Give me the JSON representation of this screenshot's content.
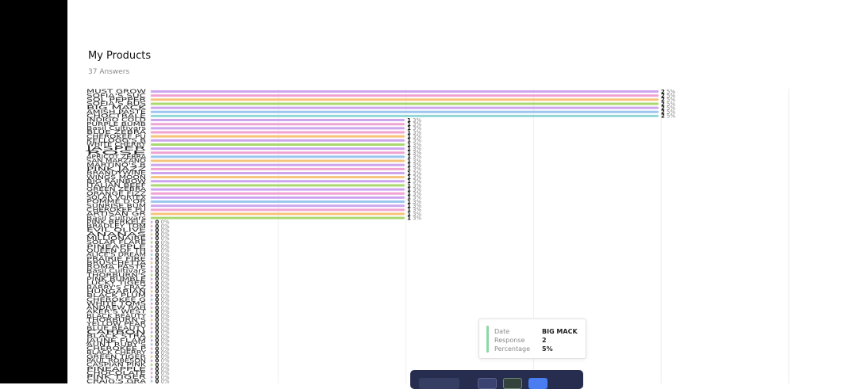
{
  "header": {
    "title": "My Products",
    "subtitle": "37 Answers"
  },
  "tooltip": {
    "date_label": "Date",
    "date_value": "BIG MACK",
    "response_label": "Response",
    "response_value": "2",
    "percentage_label": "Percentage",
    "percentage_value": "5%"
  },
  "colors": {
    "purple": "#cda5ee",
    "pink": "#f0a3d2",
    "orange": "#f7c37a",
    "green": "#a9d86e",
    "blue": "#9cc5ef",
    "teal": "#93d6d6",
    "toolbar": "#262d4f"
  },
  "chart_data": {
    "type": "bar",
    "orientation": "horizontal",
    "xlim": [
      0,
      2
    ],
    "grid": true,
    "items": [
      {
        "label": "MUST GROW",
        "value": 2,
        "pct": "5%",
        "color": "purple"
      },
      {
        "label": "SOFIA'S SUC",
        "value": 2,
        "pct": "5%",
        "color": "pink"
      },
      {
        "label": "SOL PEPPER",
        "value": 2,
        "pct": "5%",
        "color": "orange"
      },
      {
        "label": "SOFIA'S BUS",
        "value": 2,
        "pct": "5%",
        "color": "green"
      },
      {
        "label": "BIG MACK",
        "value": 2,
        "pct": "5%",
        "color": "purple"
      },
      {
        "label": "AMISH PASTE",
        "value": 2,
        "pct": "5%",
        "color": "blue"
      },
      {
        "label": "CHOCTRALE",
        "value": 2,
        "pct": "5%",
        "color": "teal"
      },
      {
        "label": "INDIGO COLD",
        "value": 1,
        "pct": "3%",
        "color": "purple"
      },
      {
        "label": "PURPLE BUMB",
        "value": 1,
        "pct": "3%",
        "color": "pink"
      },
      {
        "label": "Basil Cultivars",
        "value": 1,
        "pct": "3%",
        "color": "purple"
      },
      {
        "label": "BLUE ZEBRA",
        "value": 1,
        "pct": "3%",
        "color": "pink"
      },
      {
        "label": "CHEROKEE PU",
        "value": 1,
        "pct": "3%",
        "color": "orange"
      },
      {
        "label": "KELLOGG'S B",
        "value": 1,
        "pct": "3%",
        "color": "purple"
      },
      {
        "label": "WHITE CHERRY",
        "value": 1,
        "pct": "3%",
        "color": "green"
      },
      {
        "label": "JASPER",
        "value": 1,
        "pct": "3%",
        "color": "purple"
      },
      {
        "label": "ROSE",
        "value": 1,
        "pct": "3%",
        "color": "pink"
      },
      {
        "label": "APRICOT ZEBRA",
        "value": 1,
        "pct": "3%",
        "color": "blue"
      },
      {
        "label": "SAN MARZANO",
        "value": 1,
        "pct": "3%",
        "color": "orange"
      },
      {
        "label": "MARTINO'S R",
        "value": 1,
        "pct": "3%",
        "color": "purple"
      },
      {
        "label": "PINK JAZZ",
        "value": 1,
        "pct": "3%",
        "color": "pink"
      },
      {
        "label": "BRANDYWINE",
        "value": 1,
        "pct": "3%",
        "color": "purple"
      },
      {
        "label": "WINGS MOON",
        "value": 1,
        "pct": "3%",
        "color": "orange"
      },
      {
        "label": "BIG RAINBOW",
        "value": 1,
        "pct": "3%",
        "color": "purple"
      },
      {
        "label": "ITALIAN BEEF",
        "value": 1,
        "pct": "3%",
        "color": "green"
      },
      {
        "label": "GREEN ZEBRA",
        "value": 1,
        "pct": "3%",
        "color": "purple"
      },
      {
        "label": "ORANGE FIZZ",
        "value": 1,
        "pct": "3%",
        "color": "pink"
      },
      {
        "label": "SOLAR VORTEX",
        "value": 1,
        "pct": "3%",
        "color": "purple"
      },
      {
        "label": "POMME D'OR",
        "value": 1,
        "pct": "3%",
        "color": "blue"
      },
      {
        "label": "SUNRISE BUM",
        "value": 1,
        "pct": "3%",
        "color": "purple"
      },
      {
        "label": "CHEROKEE PU",
        "value": 1,
        "pct": "3%",
        "color": "pink"
      },
      {
        "label": "ARTISAN GR",
        "value": 1,
        "pct": "3%",
        "color": "orange"
      },
      {
        "label": "Basil Cultivars",
        "value": 1,
        "pct": "3%",
        "color": "green"
      },
      {
        "label": "PINK BERKELE",
        "value": 0,
        "pct": "0%",
        "color": "purple"
      },
      {
        "label": "BRADLEY TOM",
        "value": 0,
        "pct": "0%",
        "color": "pink"
      },
      {
        "label": "EVIL OLIVE",
        "value": 0,
        "pct": "0%",
        "color": "purple"
      },
      {
        "label": "ANANAS",
        "value": 0,
        "pct": "0%",
        "color": "orange"
      },
      {
        "label": "MILLIONAIRE",
        "value": 0,
        "pct": "0%",
        "color": "purple"
      },
      {
        "label": "SOLAR FLARE",
        "value": 0,
        "pct": "0%",
        "color": "green"
      },
      {
        "label": "PINEAPPLE",
        "value": 0,
        "pct": "0%",
        "color": "purple"
      },
      {
        "label": "QUEEN OF TH",
        "value": 0,
        "pct": "0%",
        "color": "pink"
      },
      {
        "label": "ALICE'S DREAM",
        "value": 0,
        "pct": "0%",
        "color": "blue"
      },
      {
        "label": "PRAIRIE FIRE",
        "value": 0,
        "pct": "0%",
        "color": "purple"
      },
      {
        "label": "BRUSCHETTA",
        "value": 0,
        "pct": "0%",
        "color": "orange"
      },
      {
        "label": "ROMA PASTE",
        "value": 0,
        "pct": "0%",
        "color": "purple"
      },
      {
        "label": "Basil Cultivars",
        "value": 0,
        "pct": "0%",
        "color": "pink"
      },
      {
        "label": "THORBURN'S",
        "value": 0,
        "pct": "0%",
        "color": "green"
      },
      {
        "label": "PINK BUMBLE",
        "value": 0,
        "pct": "0%",
        "color": "purple"
      },
      {
        "label": "LUCKY TIGER",
        "value": 0,
        "pct": "0%",
        "color": "pink"
      },
      {
        "label": "BARRY'S CRAZ",
        "value": 0,
        "pct": "0%",
        "color": "purple"
      },
      {
        "label": "HUNGARIAN",
        "value": 0,
        "pct": "0%",
        "color": "orange"
      },
      {
        "label": "BLACK PLUM",
        "value": 0,
        "pct": "0%",
        "color": "purple"
      },
      {
        "label": "CHEROKEE G",
        "value": 0,
        "pct": "0%",
        "color": "blue"
      },
      {
        "label": "WHITE TOMS",
        "value": 0,
        "pct": "0%",
        "color": "purple"
      },
      {
        "label": "ANDREW RAH",
        "value": 0,
        "pct": "0%",
        "color": "pink"
      },
      {
        "label": "AKER'S WEST",
        "value": 0,
        "pct": "0%",
        "color": "green"
      },
      {
        "label": "BLACK BEAUTY",
        "value": 0,
        "pct": "0%",
        "color": "purple"
      },
      {
        "label": "THORBURN'S",
        "value": 0,
        "pct": "0%",
        "color": "orange"
      },
      {
        "label": "YELLOW PEAR",
        "value": 0,
        "pct": "0%",
        "color": "purple"
      },
      {
        "label": "BLUE BEAUTY",
        "value": 0,
        "pct": "0%",
        "color": "pink"
      },
      {
        "label": "CARBON",
        "value": 0,
        "pct": "0%",
        "color": "purple"
      },
      {
        "label": "BLACK STRA",
        "value": 0,
        "pct": "0%",
        "color": "green"
      },
      {
        "label": "JAUNE FLAM",
        "value": 0,
        "pct": "0%",
        "color": "purple"
      },
      {
        "label": "AUNT RUBY'S",
        "value": 0,
        "pct": "0%",
        "color": "blue"
      },
      {
        "label": "CHEROKEE P",
        "value": 0,
        "pct": "0%",
        "color": "pink"
      },
      {
        "label": "BLACK CHERRY",
        "value": 0,
        "pct": "0%",
        "color": "purple"
      },
      {
        "label": "GREEN TIGER",
        "value": 0,
        "pct": "0%",
        "color": "orange"
      },
      {
        "label": "PAUL ROBESON",
        "value": 0,
        "pct": "0%",
        "color": "purple"
      },
      {
        "label": "CASPIAN PINK",
        "value": 0,
        "pct": "0%",
        "color": "green"
      },
      {
        "label": "PINEAPPLE",
        "value": 0,
        "pct": "0%",
        "color": "purple"
      },
      {
        "label": "CHOCOLATE",
        "value": 0,
        "pct": "0%",
        "color": "pink"
      },
      {
        "label": "PINK TIGER",
        "value": 0,
        "pct": "0%",
        "color": "purple"
      },
      {
        "label": "CRAIG'S GRA",
        "value": 0,
        "pct": "0%",
        "color": "blue"
      },
      {
        "label": "MANITOBA",
        "value": 0,
        "pct": "0%",
        "color": "purple"
      }
    ]
  }
}
